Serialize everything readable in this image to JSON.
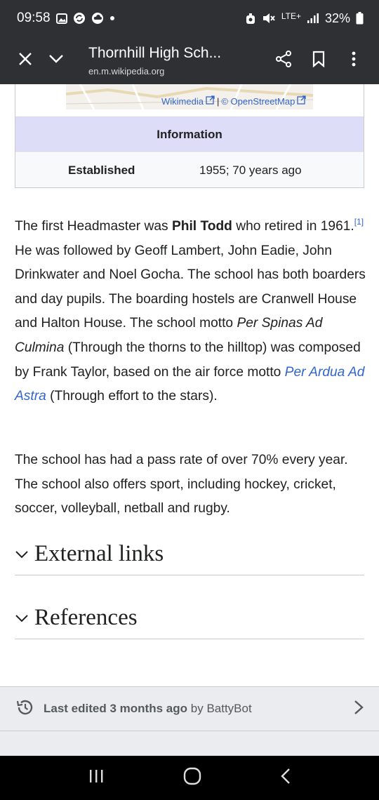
{
  "status_bar": {
    "time": "09:58",
    "network": "LTE+",
    "battery": "32%",
    "icons": [
      "gallery-icon",
      "sync-icon",
      "cloud-icon",
      "dot-icon",
      "alarm-icon",
      "mute-icon",
      "signal-icon",
      "battery-icon"
    ]
  },
  "header": {
    "title": "Thornhill High Sch...",
    "url": "en.m.wikipedia.org",
    "icons": [
      "close-icon",
      "chevron-down-icon",
      "share-icon",
      "bookmark-icon",
      "more-icon"
    ]
  },
  "map": {
    "attribution_wikimedia": "Wikimedia",
    "attribution_sep": "|",
    "attribution_osm": "© OpenStreetMap"
  },
  "infobox": {
    "header": "Information",
    "rows": [
      {
        "label": "Established",
        "value": "1955; 70 years ago"
      }
    ]
  },
  "article": {
    "p1": {
      "t1": "The first Headmaster was ",
      "b1": "Phil Todd",
      "t2": " who retired in 1961.",
      "sup": "[1]",
      "t3": " He was followed by Geoff Lambert, John Eadie, John Drinkwater and Noel Gocha. The school has both boarders and day pupils. The boarding hostels are Cranwell House and Halton House. The school motto ",
      "i1": "Per Spinas Ad Culmina",
      "t4": " (Through the thorns to the hilltop) was composed by Frank Taylor, based on the air force motto ",
      "link": "Per Ardua Ad Astra",
      "t5": " (Through effort to the stars)."
    },
    "p2": "The school has had a pass rate of over 70% every year. The school also offers sport, including hockey, cricket, soccer, volleyball, netball and rugby."
  },
  "sections": [
    {
      "title": "External links"
    },
    {
      "title": "References"
    }
  ],
  "footer": {
    "edited_prefix": "Last edited",
    "edited_when": "3 months ago",
    "edited_by_prefix": "by",
    "edited_by": "BattyBot"
  },
  "nav": {
    "icons": [
      "recents-icon",
      "home-icon",
      "back-icon"
    ]
  },
  "colors": {
    "header_bg": "#2f3033",
    "link": "#3366cc",
    "infobox_header_bg": "#ddddf8",
    "footer_bg": "#eaecf0"
  }
}
